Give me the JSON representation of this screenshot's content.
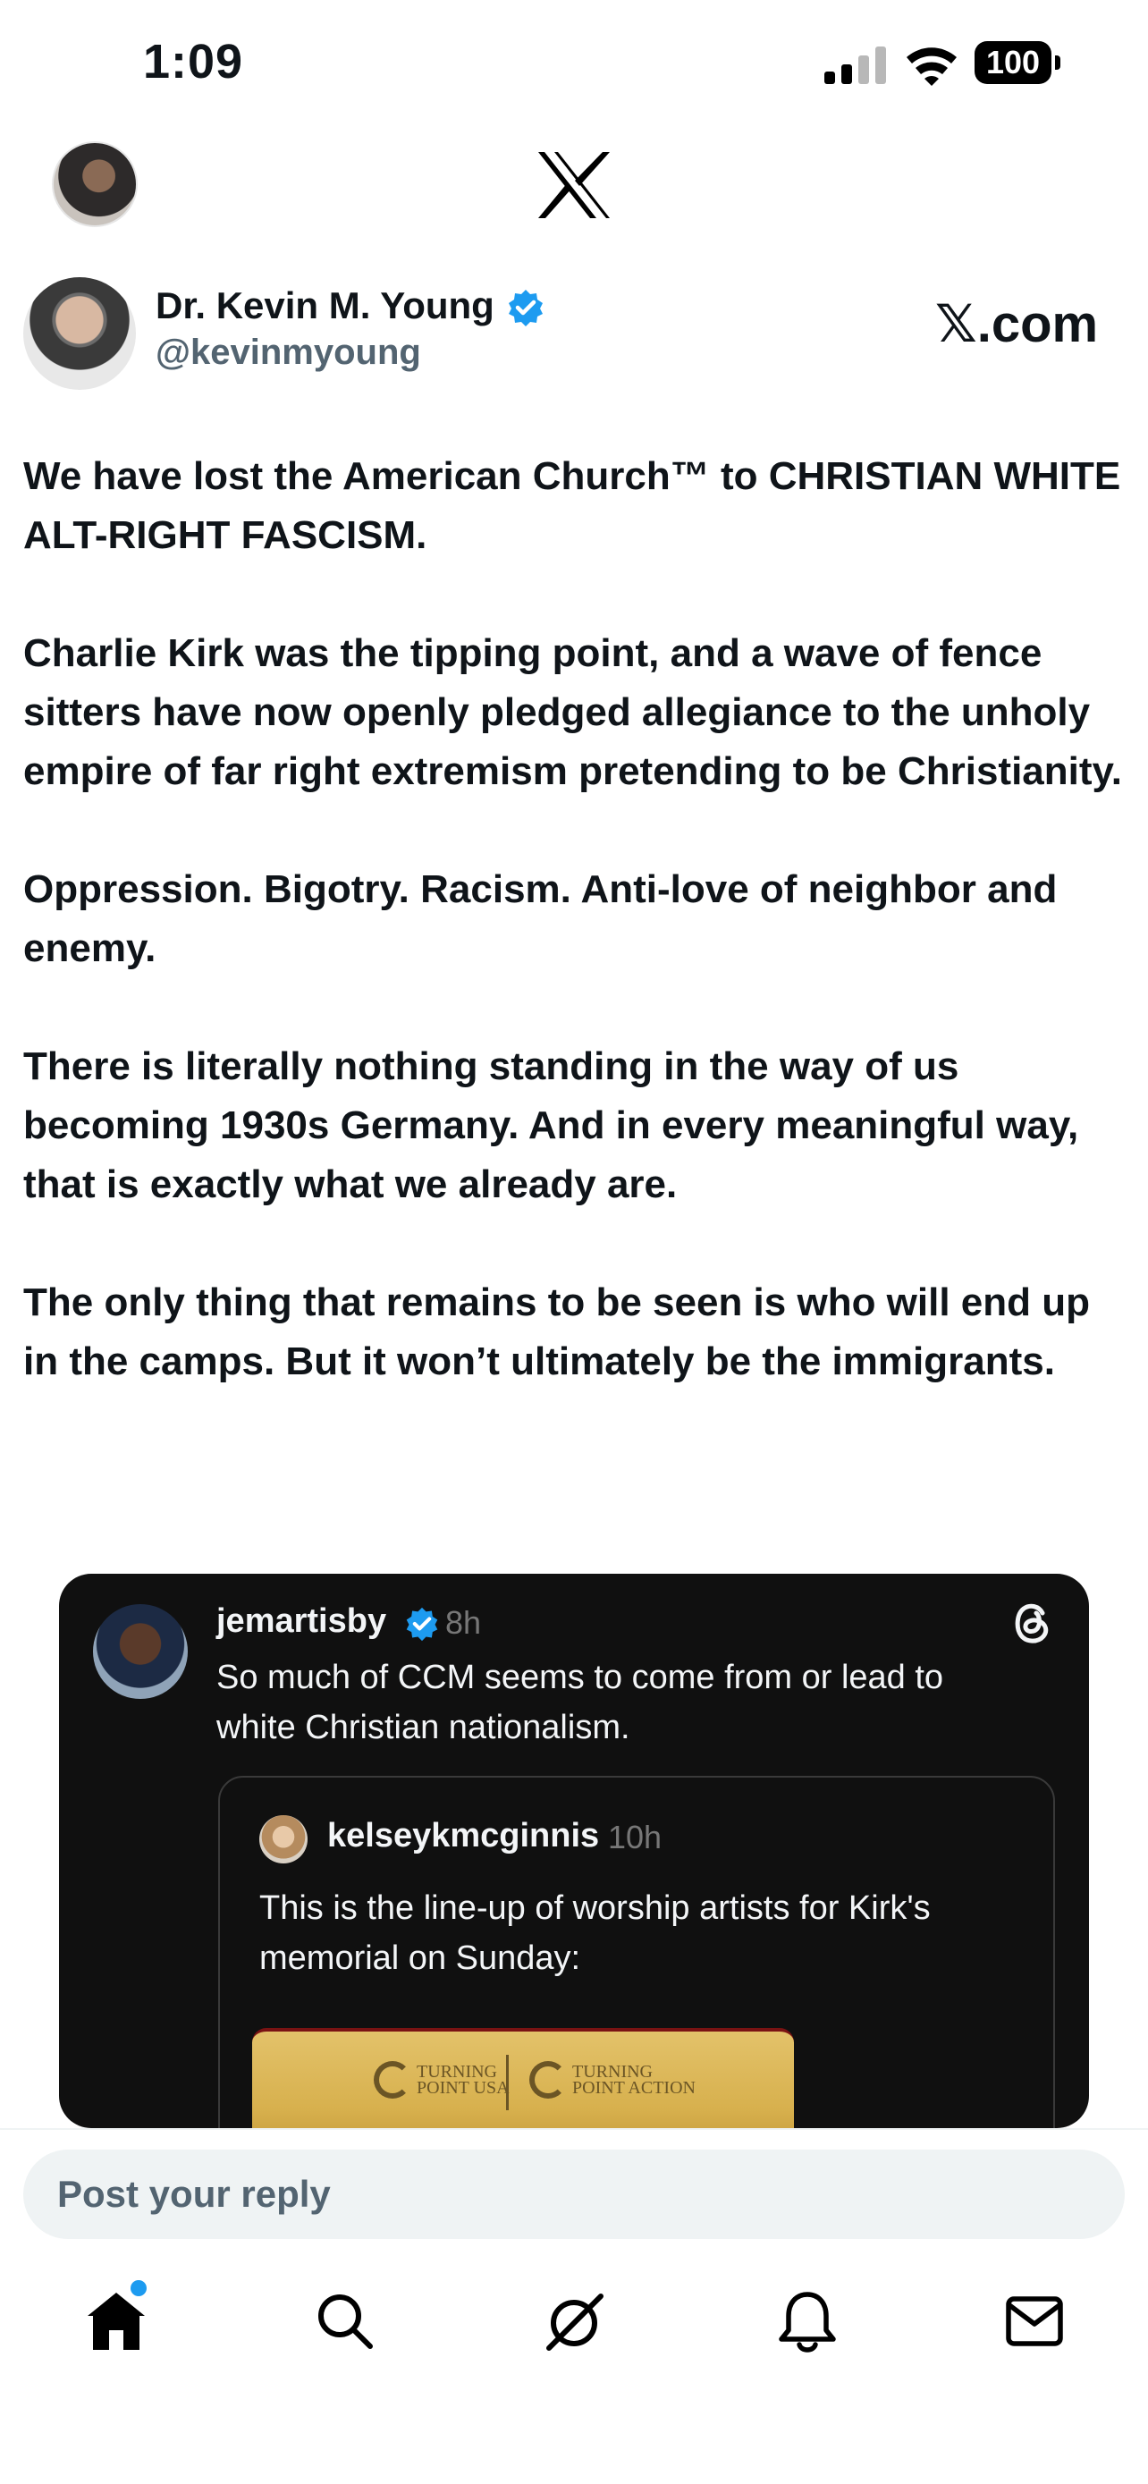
{
  "status_bar": {
    "time": "1:09",
    "battery": "100"
  },
  "colors": {
    "accent": "#1d9bf0",
    "text": "#0f1419",
    "secondary_text": "#536471",
    "embed_background": "#101010"
  },
  "icons": [
    "cellular-signal-icon",
    "wifi-icon",
    "battery-icon",
    "x-logo-icon",
    "verified-badge-icon",
    "threads-icon",
    "home-icon",
    "search-icon",
    "grok-icon",
    "notifications-icon",
    "messages-icon"
  ],
  "post": {
    "author_name": "Dr. Kevin M. Young",
    "author_handle": "@kevinmyoung",
    "source": "𝕏.com",
    "paragraphs": [
      "We have lost the American Church™ to CHRISTIAN WHITE ALT-RIGHT FASCISM.",
      "Charlie Kirk was the tipping point, and a wave of fence sitters have now openly pledged allegiance to the unholy empire of far right extremism pretending to be Christianity.",
      "Oppression. Bigotry. Racism. Anti-love of neighbor and enemy.",
      "There is literally nothing standing in the way of us becoming 1930s Germany. And in every meaningful way, that is exactly what we already are.",
      "The only thing that remains to be seen is who will end up in the camps. But it won’t ultimately be the immigrants."
    ]
  },
  "embed": {
    "username": "jemartisby",
    "time": "8h",
    "text": "So much of CCM seems to come from or lead to white Christian nationalism.",
    "quote": {
      "username": "kelseykmcginnis",
      "time": "10h",
      "text": "This is the line-up of worship artists for Kirk's memorial on Sunday:",
      "image_logo_left_1": "TURNING",
      "image_logo_left_2": "POINT USA",
      "image_logo_right_1": "TURNING",
      "image_logo_right_2": "POINT ACTION"
    }
  },
  "reply": {
    "placeholder": "Post your reply"
  }
}
